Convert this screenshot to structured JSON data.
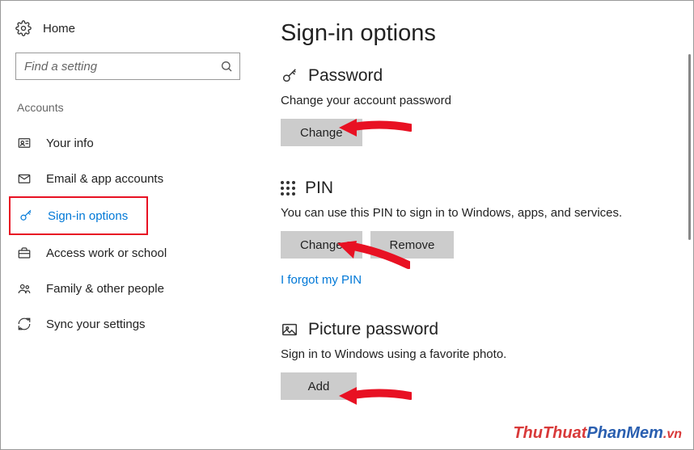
{
  "sidebar": {
    "home": "Home",
    "searchPlaceholder": "Find a setting",
    "sectionLabel": "Accounts",
    "items": [
      {
        "label": "Your info"
      },
      {
        "label": "Email & app accounts"
      },
      {
        "label": "Sign-in options"
      },
      {
        "label": "Access work or school"
      },
      {
        "label": "Family & other people"
      },
      {
        "label": "Sync your settings"
      }
    ]
  },
  "main": {
    "title": "Sign-in options",
    "password": {
      "heading": "Password",
      "desc": "Change your account password",
      "changeBtn": "Change"
    },
    "pin": {
      "heading": "PIN",
      "desc": "You can use this PIN to sign in to Windows, apps, and services.",
      "changeBtn": "Change",
      "removeBtn": "Remove",
      "forgotLink": "I forgot my PIN"
    },
    "picture": {
      "heading": "Picture password",
      "desc": "Sign in to Windows using a favorite photo.",
      "addBtn": "Add"
    }
  },
  "watermark": {
    "p1": "ThuThuat",
    "p2": "PhanMem",
    "p3": ".vn"
  }
}
